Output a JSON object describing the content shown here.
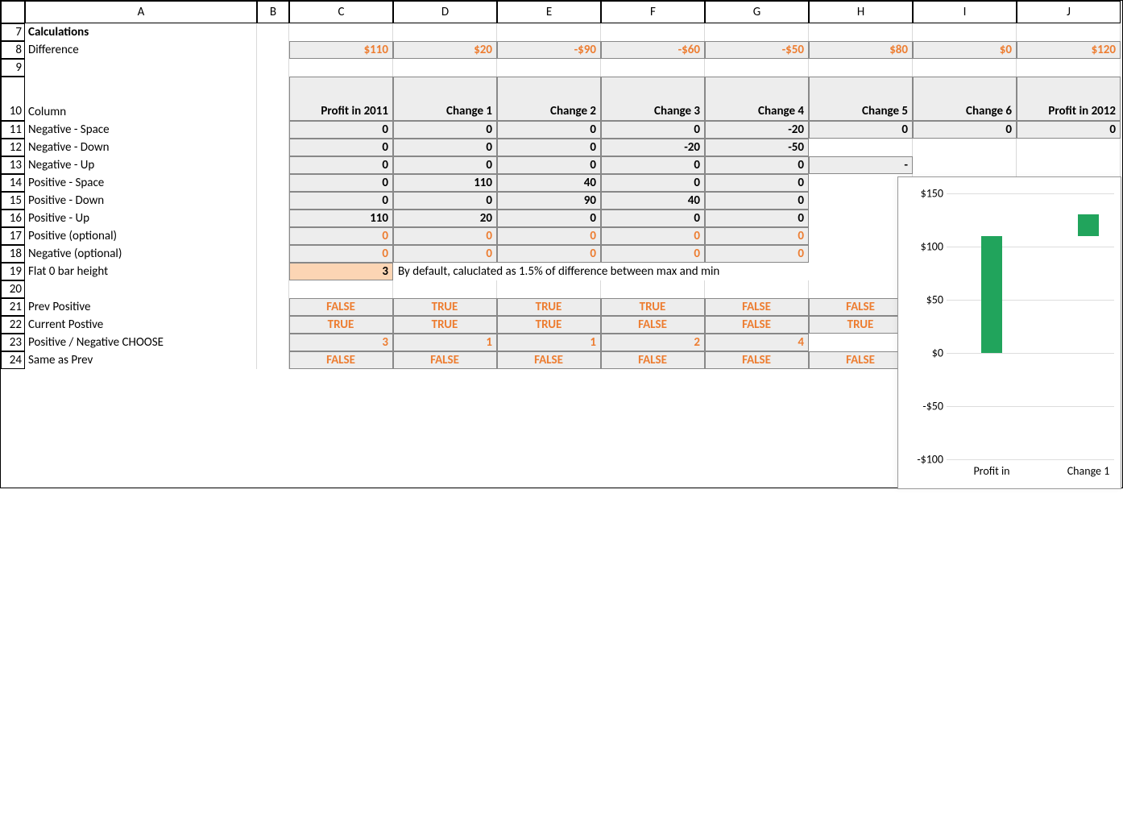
{
  "header_cols": [
    "",
    "A",
    "B",
    "C",
    "D",
    "E",
    "F",
    "G",
    "H",
    "I",
    "J"
  ],
  "rows": {
    "7": {
      "num": "7",
      "A": "Calculations"
    },
    "8": {
      "num": "8",
      "A": "Difference",
      "vals": [
        "$110",
        "$20",
        "-$90",
        "-$60",
        "-$50",
        "$80",
        "$0",
        "$120"
      ]
    },
    "9": {
      "num": "9"
    },
    "10": {
      "num": "10",
      "A": "Column",
      "vals": [
        "Profit in 2011",
        "Change 1",
        "Change 2",
        "Change 3",
        "Change 4",
        "Change 5",
        "Change 6",
        "Profit in 2012"
      ]
    },
    "11": {
      "num": "11",
      "A": "Negative - Space",
      "vals": [
        "0",
        "0",
        "0",
        "0",
        "-20",
        "0",
        "0",
        "0"
      ]
    },
    "12": {
      "num": "12",
      "A": "Negative - Down",
      "vals": [
        "0",
        "0",
        "0",
        "-20",
        "-50",
        "",
        "",
        ""
      ]
    },
    "13": {
      "num": "13",
      "A": "Negative - Up",
      "vals": [
        "0",
        "0",
        "0",
        "0",
        "0",
        "-",
        "",
        ""
      ]
    },
    "14": {
      "num": "14",
      "A": "Positive - Space",
      "vals": [
        "0",
        "110",
        "40",
        "0",
        "0",
        "",
        "",
        ""
      ]
    },
    "15": {
      "num": "15",
      "A": "Positive - Down",
      "vals": [
        "0",
        "0",
        "90",
        "40",
        "0",
        "",
        "",
        ""
      ]
    },
    "16": {
      "num": "16",
      "A": "Positive - Up",
      "vals": [
        "110",
        "20",
        "0",
        "0",
        "0",
        "",
        "",
        ""
      ]
    },
    "17": {
      "num": "17",
      "A": "Positive (optional)",
      "vals": [
        "0",
        "0",
        "0",
        "0",
        "0",
        "",
        "",
        ""
      ]
    },
    "18": {
      "num": "18",
      "A": "Negative (optional)",
      "vals": [
        "0",
        "0",
        "0",
        "0",
        "0",
        "",
        "",
        ""
      ]
    },
    "19": {
      "num": "19",
      "A": "Flat 0 bar height",
      "val": "3",
      "note": "By default, caluclated as 1.5% of difference between max and min"
    },
    "20": {
      "num": "20"
    },
    "21": {
      "num": "21",
      "A": "Prev Positive",
      "vals": [
        "FALSE",
        "TRUE",
        "TRUE",
        "TRUE",
        "FALSE",
        "FALSE",
        "",
        ""
      ]
    },
    "22": {
      "num": "22",
      "A": "Current Postive",
      "vals": [
        "TRUE",
        "TRUE",
        "TRUE",
        "FALSE",
        "FALSE",
        "TRUE",
        "",
        ""
      ]
    },
    "23": {
      "num": "23",
      "A": "Positive / Negative CHOOSE",
      "vals": [
        "3",
        "1",
        "1",
        "2",
        "4",
        "",
        "",
        ""
      ]
    },
    "24": {
      "num": "24",
      "A": "Same as Prev",
      "vals": [
        "FALSE",
        "FALSE",
        "FALSE",
        "FALSE",
        "FALSE",
        "FALSE",
        "",
        ""
      ]
    }
  },
  "chart_data": {
    "type": "bar",
    "title": "",
    "y_ticks": [
      "$150",
      "$100",
      "$50",
      "$0",
      "-$50",
      "-$100"
    ],
    "ylim": [
      -100,
      150
    ],
    "categories": [
      "Profit in",
      "Change 1"
    ],
    "series": [
      {
        "name": "bar1",
        "bottom": 0,
        "top": 110,
        "x": 0
      },
      {
        "name": "bar2",
        "bottom": 110,
        "top": 130,
        "x": 1
      }
    ]
  }
}
